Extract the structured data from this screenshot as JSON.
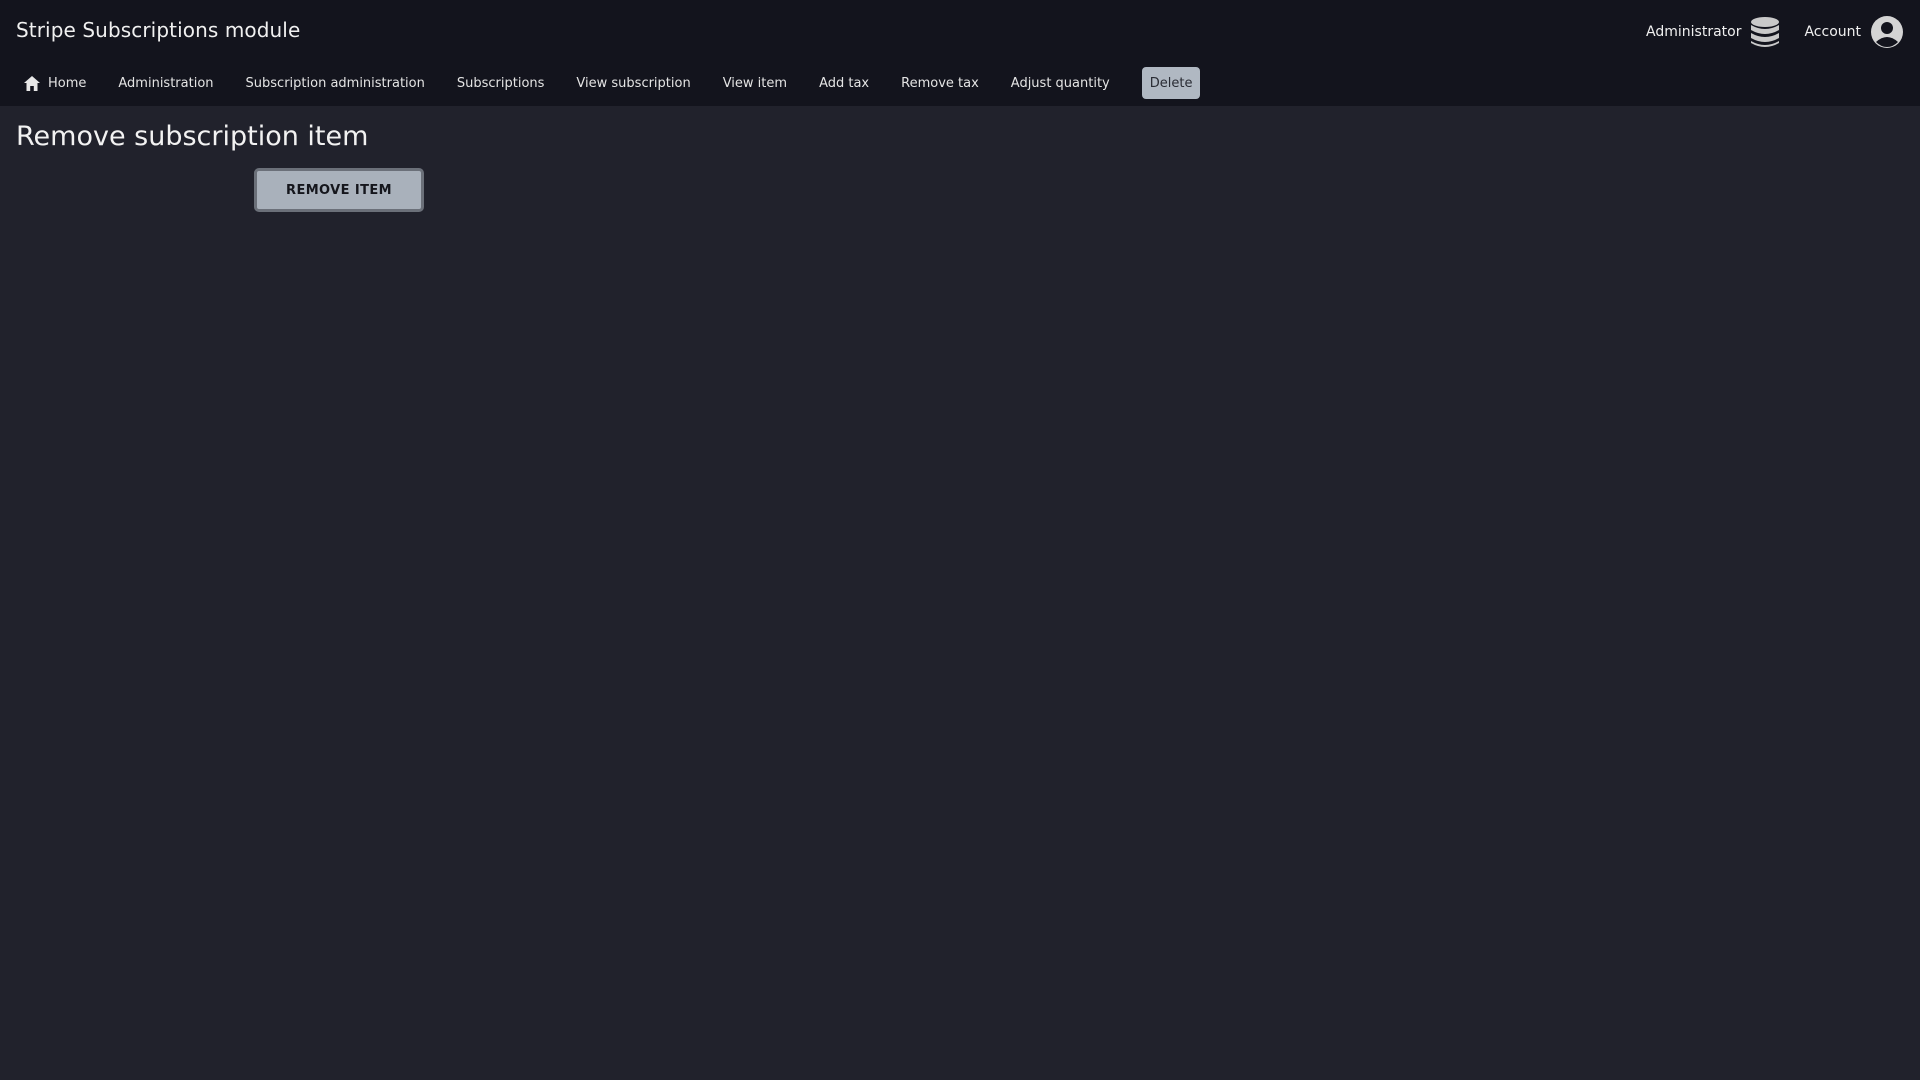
{
  "app": {
    "title": "Stripe Subscriptions module"
  },
  "user_menu": {
    "role_label": "Administrator",
    "role_icon": "database-icon",
    "account_label": "Account",
    "account_icon": "user-circle-icon"
  },
  "nav": {
    "items": [
      {
        "label": "Home",
        "icon": "home-icon"
      },
      {
        "label": "Administration"
      },
      {
        "label": "Subscription administration"
      },
      {
        "label": "Subscriptions"
      },
      {
        "label": "View subscription"
      },
      {
        "label": "View item"
      },
      {
        "label": "Add tax"
      },
      {
        "label": "Remove tax"
      },
      {
        "label": "Adjust quantity"
      },
      {
        "label": "Delete",
        "active": true
      }
    ]
  },
  "main": {
    "title": "Remove subscription item",
    "submit_label": "REMOVE ITEM"
  },
  "colors": {
    "background": "#21222c",
    "header": "#13141d",
    "active_tab": "#b0b8c2",
    "button": "#a9b1bb"
  }
}
